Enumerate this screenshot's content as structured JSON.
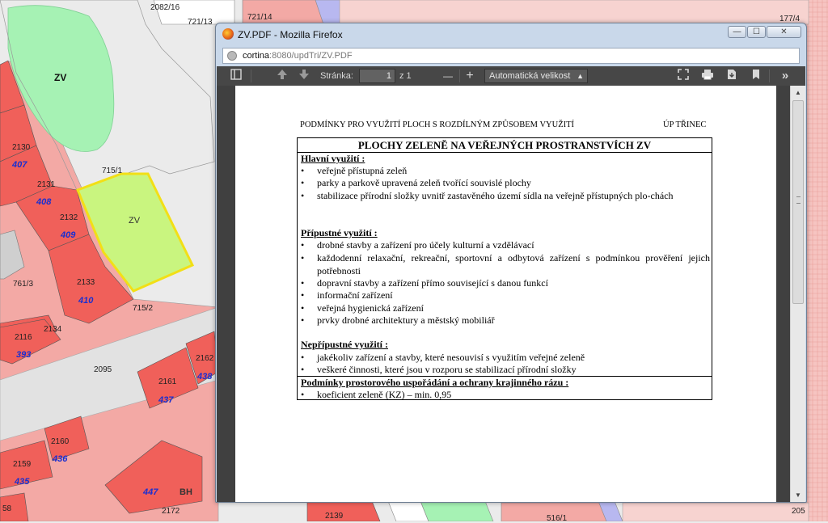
{
  "map": {
    "labels": [
      "2082/16",
      "721/13",
      "721/14",
      "177/4",
      "ZV",
      "2130",
      "407",
      "2131",
      "408",
      "2132",
      "409",
      "715/1",
      "ZV",
      "761/3",
      "2133",
      "410",
      "715/2",
      "2116",
      "2134",
      "393",
      "2095",
      "2162",
      "438",
      "2161",
      "437",
      "2160",
      "436",
      "2159",
      "435",
      "447",
      "BH",
      "2172",
      "2139",
      "516/1",
      "205",
      "58"
    ],
    "colors": {
      "building": "#f0605a",
      "plot_pink": "#f3a9a5",
      "green_zone": "#a6f2b4",
      "selected_zone": "#c9f57f",
      "selection_outline": "#f2df16",
      "road": "#ebebeb"
    }
  },
  "window": {
    "title": "ZV.PDF - Mozilla Firefox",
    "url_host": "cortina",
    "url_rest": ":8080/updTri/ZV.PDF",
    "controls": {
      "minimize": "—",
      "maximize": "☐",
      "close": "✕"
    }
  },
  "pdf_toolbar": {
    "page_label": "Stránka:",
    "page_value": "1",
    "page_total": "z 1",
    "zoom_out": "—",
    "zoom_in": "+",
    "zoom_value": "Automatická velikost",
    "icons": [
      "sidebar-toggle-icon",
      "previous-page-icon",
      "next-page-icon",
      "presentation-mode-icon",
      "print-icon",
      "download-icon",
      "bookmark-icon",
      "tools-icon"
    ]
  },
  "document": {
    "header_left": "PODMÍNKY PRO VYUŽITÍ PLOCH S ROZDÍLNÝM ZPŮSOBEM VYUŽITÍ",
    "header_right": "ÚP TŘINEC",
    "title": "PLOCHY ZELENĚ NA VEŘEJNÝCH PROSTRANSTVÍCH   ZV",
    "bullet": "•",
    "main_use": {
      "heading": "Hlavní využití :",
      "items": [
        "veřejně přístupná zeleň",
        "parky a parkově upravená zeleň tvořící souvislé plochy",
        "stabilizace přírodní složky uvnitř zastavěného území sídla na veřejně přístupných plo-chách"
      ]
    },
    "allowed_use": {
      "heading": "Přípustné využití :",
      "items": [
        "drobné stavby a zařízení pro účely kulturní a vzdělávací",
        "každodenní relaxační, rekreační, sportovní a odbytová zařízení s podmínkou prověření jejich potřebnosti",
        "dopravní stavby a zařízení přímo související s danou funkcí",
        "informační zařízení",
        "veřejná hygienická zařízení",
        "prvky drobné architektury a městský mobiliář"
      ]
    },
    "forbidden_use": {
      "heading": "Nepřípustné využití :",
      "items": [
        "jakékoliv zařízení a stavby, které nesouvisí s využitím veřejné zeleně",
        "veškeré činnosti, které jsou v rozporu se stabilizací přírodní složky"
      ]
    },
    "spatial": {
      "heading": "Podmínky prostorového uspořádání a ochrany krajinného rázu :",
      "items": [
        "koeficient zeleně (KZ) – min. 0,95"
      ]
    }
  }
}
